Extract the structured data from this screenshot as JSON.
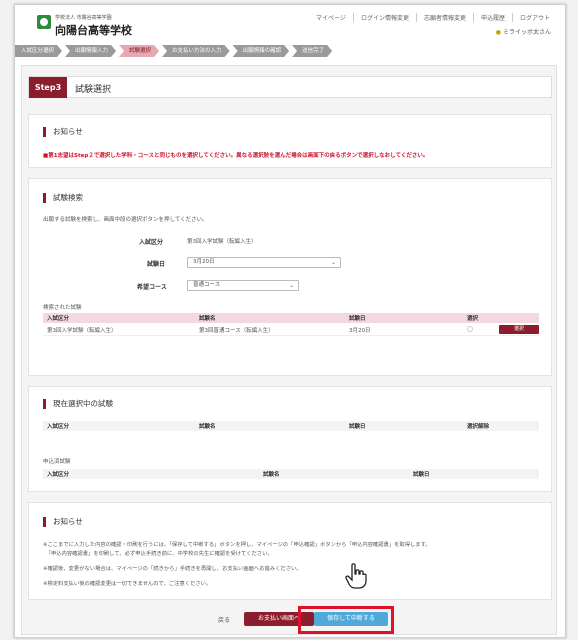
{
  "header": {
    "school_sub": "学校法人 市霧谷高等学園",
    "school_name": "向陽台高等学校",
    "links": [
      "マイページ",
      "ログイン情報変更",
      "志願者情報変更",
      "申込履歴",
      "ログアウト"
    ],
    "user": "ミライッボ太さん"
  },
  "steps": [
    "入試区分選択",
    "出願情報入力",
    "試験選択",
    "お支払い方法の入力",
    "出願情報の確認",
    "送信完了"
  ],
  "step_header": {
    "badge": "Step3",
    "title": "試験選択"
  },
  "notice1": {
    "title": "お知らせ",
    "text": "■第1志望はStep２で選択した学科・コースと同じものを選択してください。異なる選択肢を選んだ場合は画面下の戻るボタンで選択しなおしてください。"
  },
  "search": {
    "title": "試験検索",
    "desc": "出願する試験を検索し、画面中段の選択ボタンを押してください。",
    "fields": [
      {
        "label": "入試区分",
        "value": "第3回入学試験（転編入生）"
      },
      {
        "label": "試験日",
        "value": "3月20日"
      },
      {
        "label": "希望コース",
        "value": "普通コース"
      }
    ],
    "results_label": "検索された試験",
    "columns": [
      "入試区分",
      "試験名",
      "試験日",
      "選択"
    ],
    "rows": [
      {
        "category": "第3回入学試験（転編入生）",
        "name": "第3回普通コース（転編入生）",
        "date": "3月20日",
        "button": "選択"
      }
    ]
  },
  "selected": {
    "title": "現在選択中の試験",
    "columns": [
      "入試区分",
      "試験名",
      "試験日",
      "選択解除"
    ],
    "applied_label": "申込済試験",
    "applied_columns": [
      "入試区分",
      "試験名",
      "試験日"
    ]
  },
  "notice2": {
    "title": "お知らせ",
    "lines": [
      "※ここまでに入力した内容の確認・印刷を行うには、「保存して中断する」ボタンを押し、マイページの「申込確認」ボタンから「申込内容確認書」を取得します。",
      "　「申込内容確認書」を印刷して、必ず申込手続き前に、中学校の先生に確認を受けてください。",
      "※確認後、変更がない場合は、マイページの「続きから」手続きを再開し、お支払い画面へお進みください。",
      "※検定料支払い後の確認変更は一切できませんので、ご注意ください。"
    ]
  },
  "buttons": {
    "back": "戻る",
    "pay": "お支払い画面へ",
    "save": "保存して中断する"
  }
}
